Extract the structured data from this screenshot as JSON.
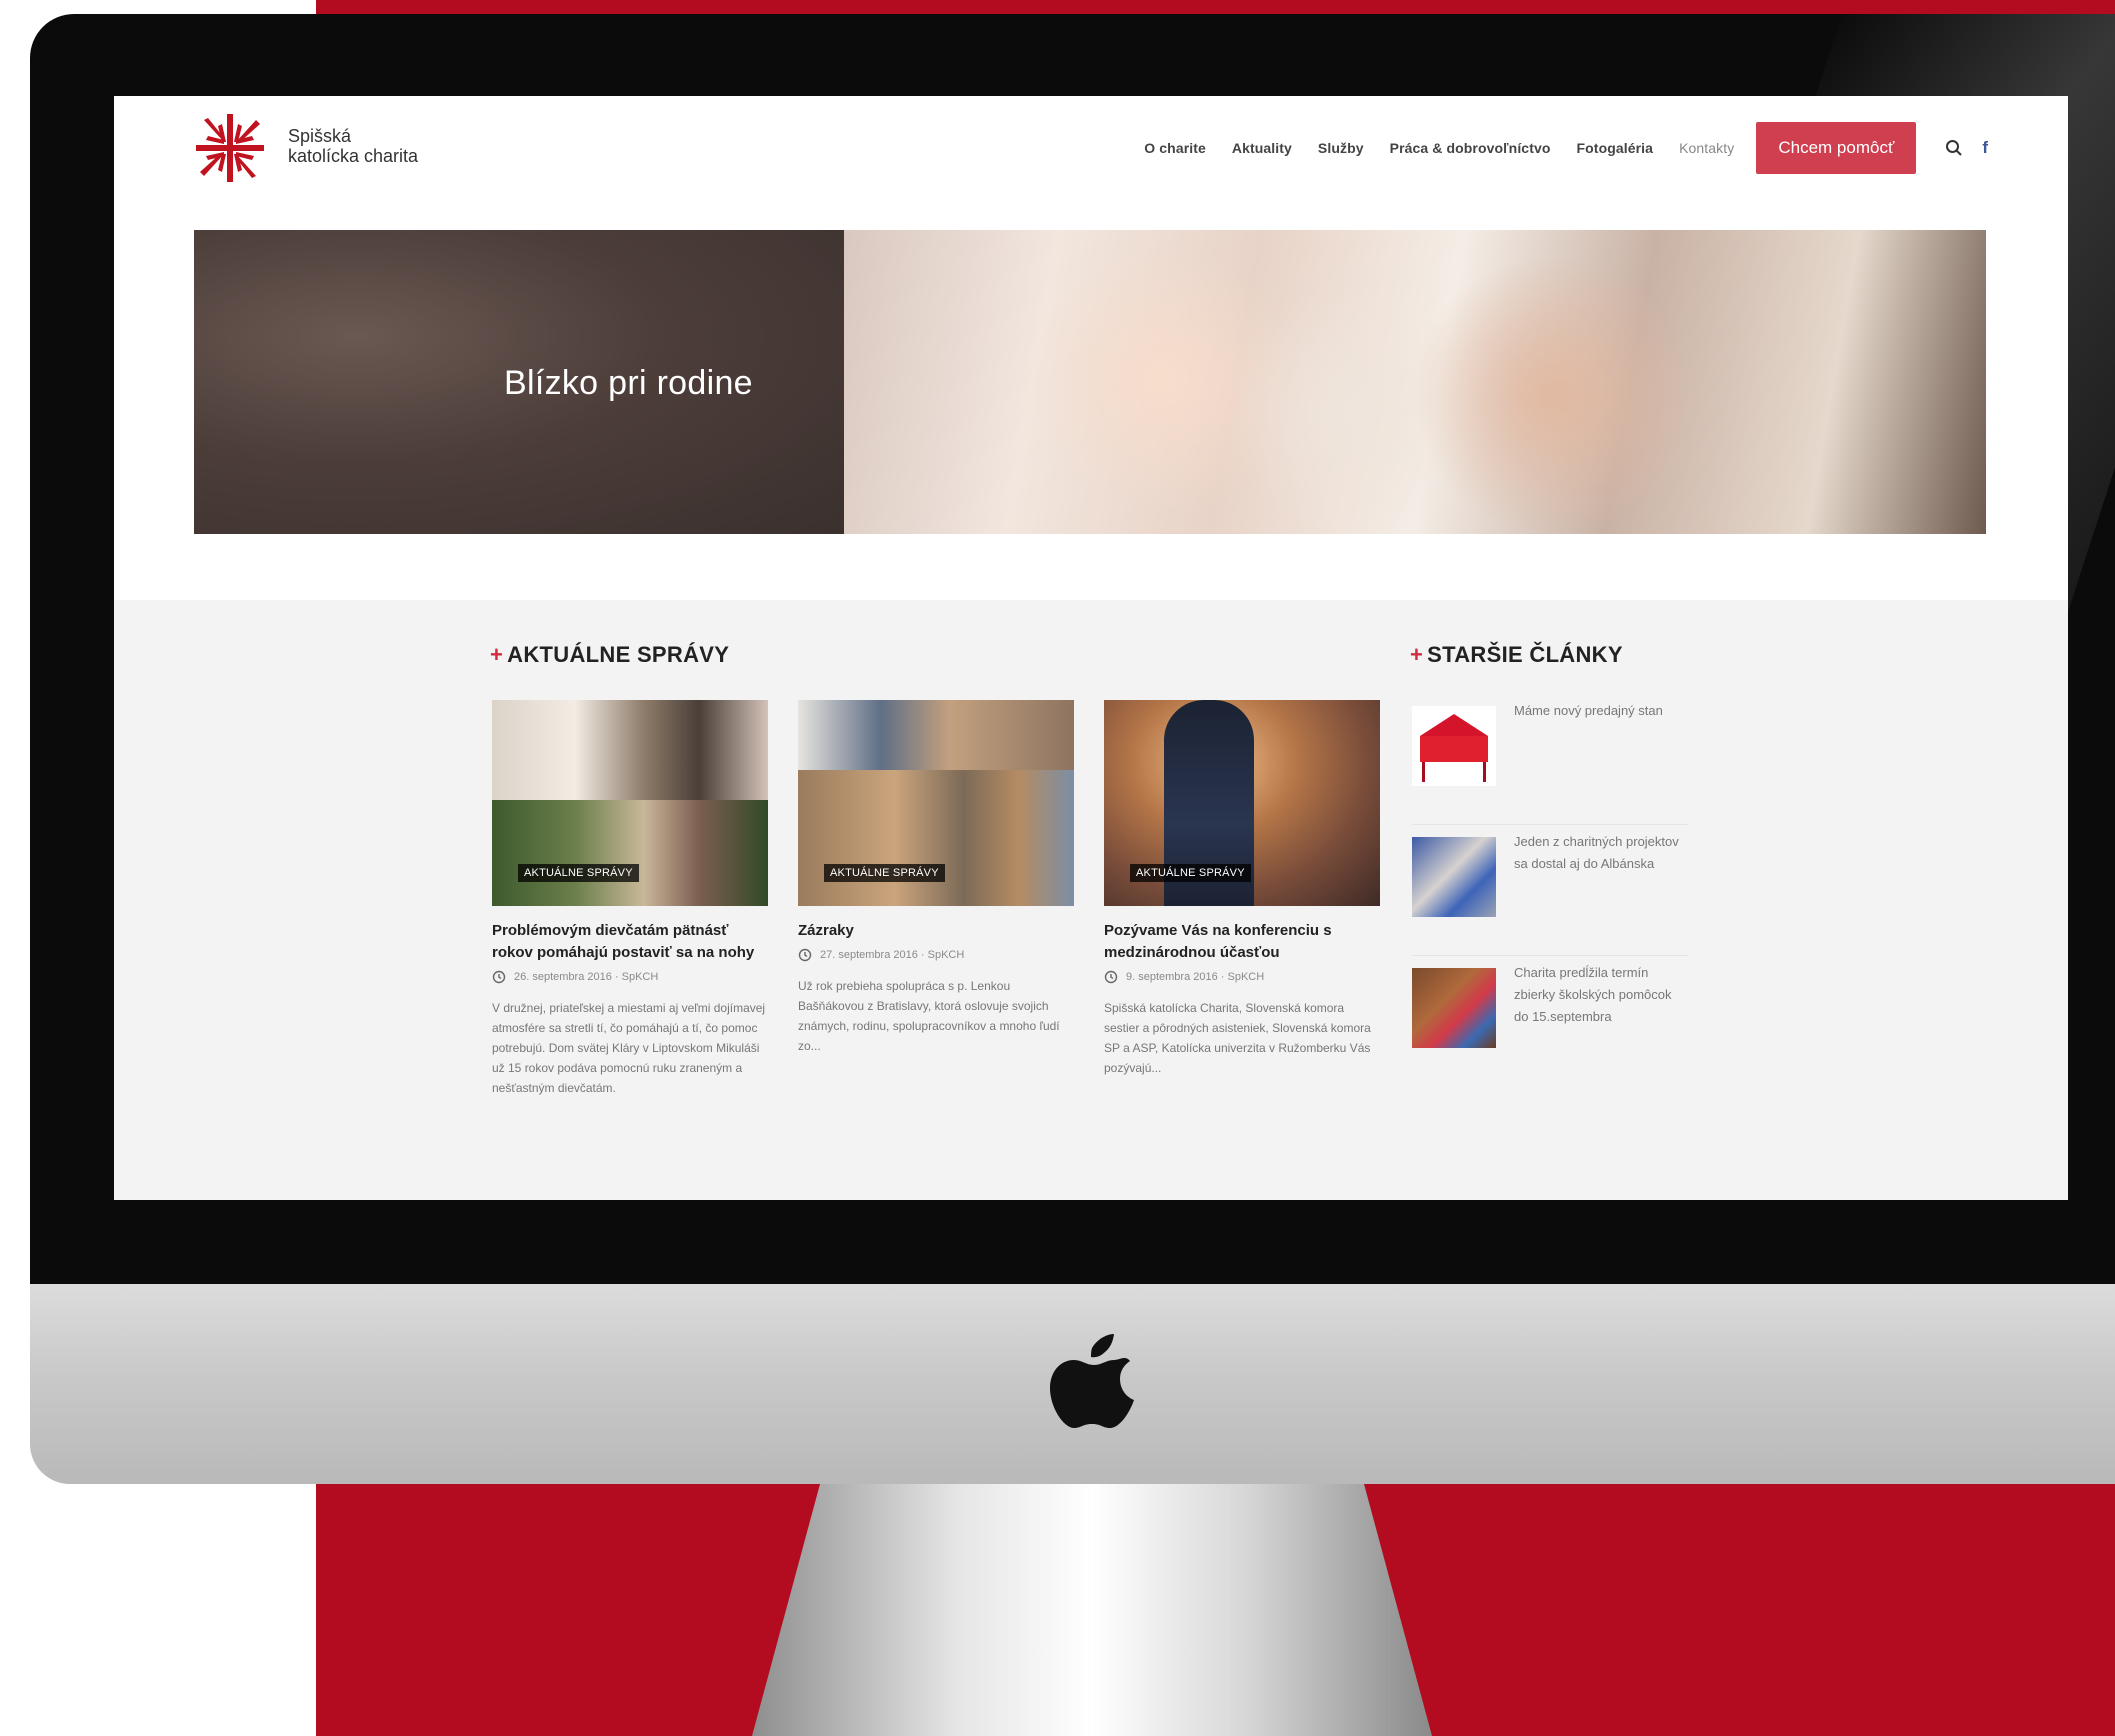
{
  "colors": {
    "accent": "#cf3f4f",
    "brand_red": "#b30c20",
    "facebook": "#3b5998"
  },
  "header": {
    "logo_icon": "caritas-cross-logo",
    "logo_line1": "Spišská",
    "logo_line2": "katolícka charita",
    "nav": [
      "O charite",
      "Aktuality",
      "Služby",
      "Práca & dobrovoľníctvo",
      "Fotogaléria",
      "Kontakty"
    ],
    "cta_label": "Chcem pomôcť",
    "search_icon": "search-icon",
    "facebook_label": "f"
  },
  "hero": {
    "title": "Blízko pri rodine"
  },
  "news": {
    "section_title": "AKTUÁLNE SPRÁVY",
    "cards": [
      {
        "badge": "AKTUÁLNE SPRÁVY",
        "title": "Problémovým dievčatám pätnásť rokov pomáhajú postaviť sa na nohy",
        "meta": "26. septembra 2016 · SpKCH",
        "excerpt": "V družnej, priateľskej a miestami aj veľmi dojímavej atmosfére sa stretli tí, čo pomáhajú a tí, čo pomoc potrebujú. Dom svätej Kláry v Liptovskom Mikuláši už 15 rokov podáva pomocnú ruku zraneným a nešťastným dievčatám."
      },
      {
        "badge": "AKTUÁLNE SPRÁVY",
        "title": "Zázraky",
        "meta": "27. septembra 2016 · SpKCH",
        "excerpt": "Už rok prebieha spolupráca s p. Lenkou Bašňákovou z Bratislavy, ktorá oslovuje svojich známych, rodinu, spolupracovníkov a mnoho ľudí zo..."
      },
      {
        "badge": "AKTUÁLNE SPRÁVY",
        "title": "Pozývame Vás na konferenciu s medzinárodnou účasťou",
        "meta": "9. septembra 2016 · SpKCH",
        "excerpt": "Spišská katolícka Charita, Slovenská komora sestier a pôrodných asisteniek, Slovenská komora SP a ASP, Katolícka univerzita v Ružomberku Vás pozývajú..."
      }
    ]
  },
  "older": {
    "section_title": "STARŠIE ČLÁNKY",
    "items": [
      {
        "text": "Máme nový predajný stan"
      },
      {
        "text": "Jeden z charitných projektov sa dostal aj do Albánska"
      },
      {
        "text": "Charita predĺžila termín zbierky školských pomôcok do 15.septembra"
      }
    ]
  }
}
